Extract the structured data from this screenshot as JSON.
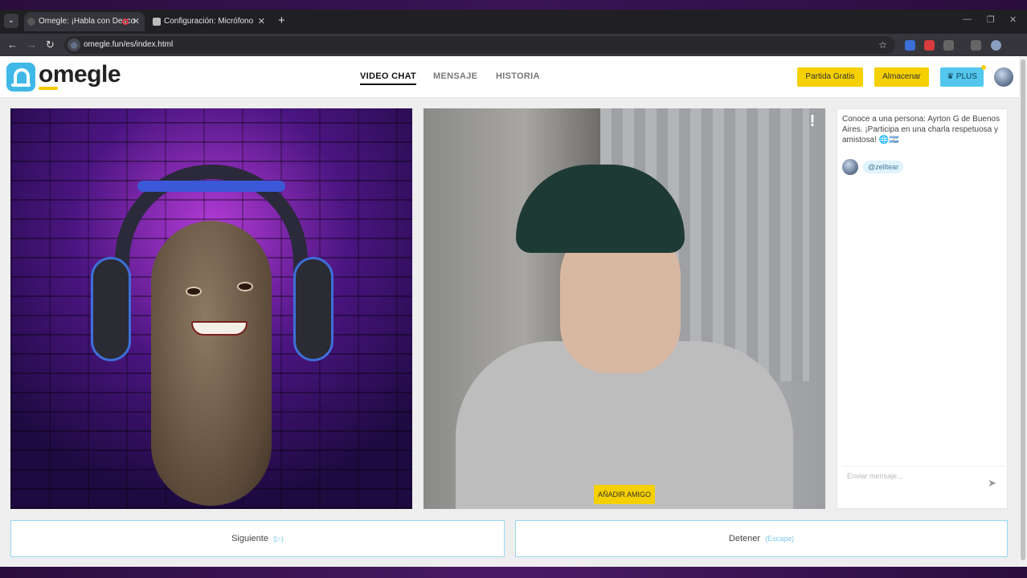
{
  "browser": {
    "tabs": [
      {
        "title": "Omegle: ¡Habla con Desco",
        "active": true
      },
      {
        "title": "Configuración: Micrófono",
        "active": false
      }
    ],
    "url": "omegle.fun/es/index.html"
  },
  "header": {
    "logo_text": "omegle",
    "nav": [
      "VIDEO CHAT",
      "MENSAJE",
      "HISTORIA"
    ],
    "partida_gratis": "Partida Gratis",
    "almacenar": "Almacenar",
    "plus": "♛ PLUS"
  },
  "video": {
    "report_label": "!",
    "add_friend": "AÑADIR AMIGO"
  },
  "chat": {
    "intro": "Conoce a una persona: Ayrton G de Buenos Aires. ¡Participa en una charla respetuosa y amistosa! 🌐🇦🇷",
    "username": "@zelltear",
    "input_placeholder": "Enviar mensaje..."
  },
  "controls": {
    "next_label": "Siguiente",
    "next_hint": "(▷)",
    "stop_label": "Detener",
    "stop_hint": "(Escape)"
  },
  "colors": {
    "accent_yellow": "#f5d000",
    "accent_blue": "#54c7ee"
  }
}
